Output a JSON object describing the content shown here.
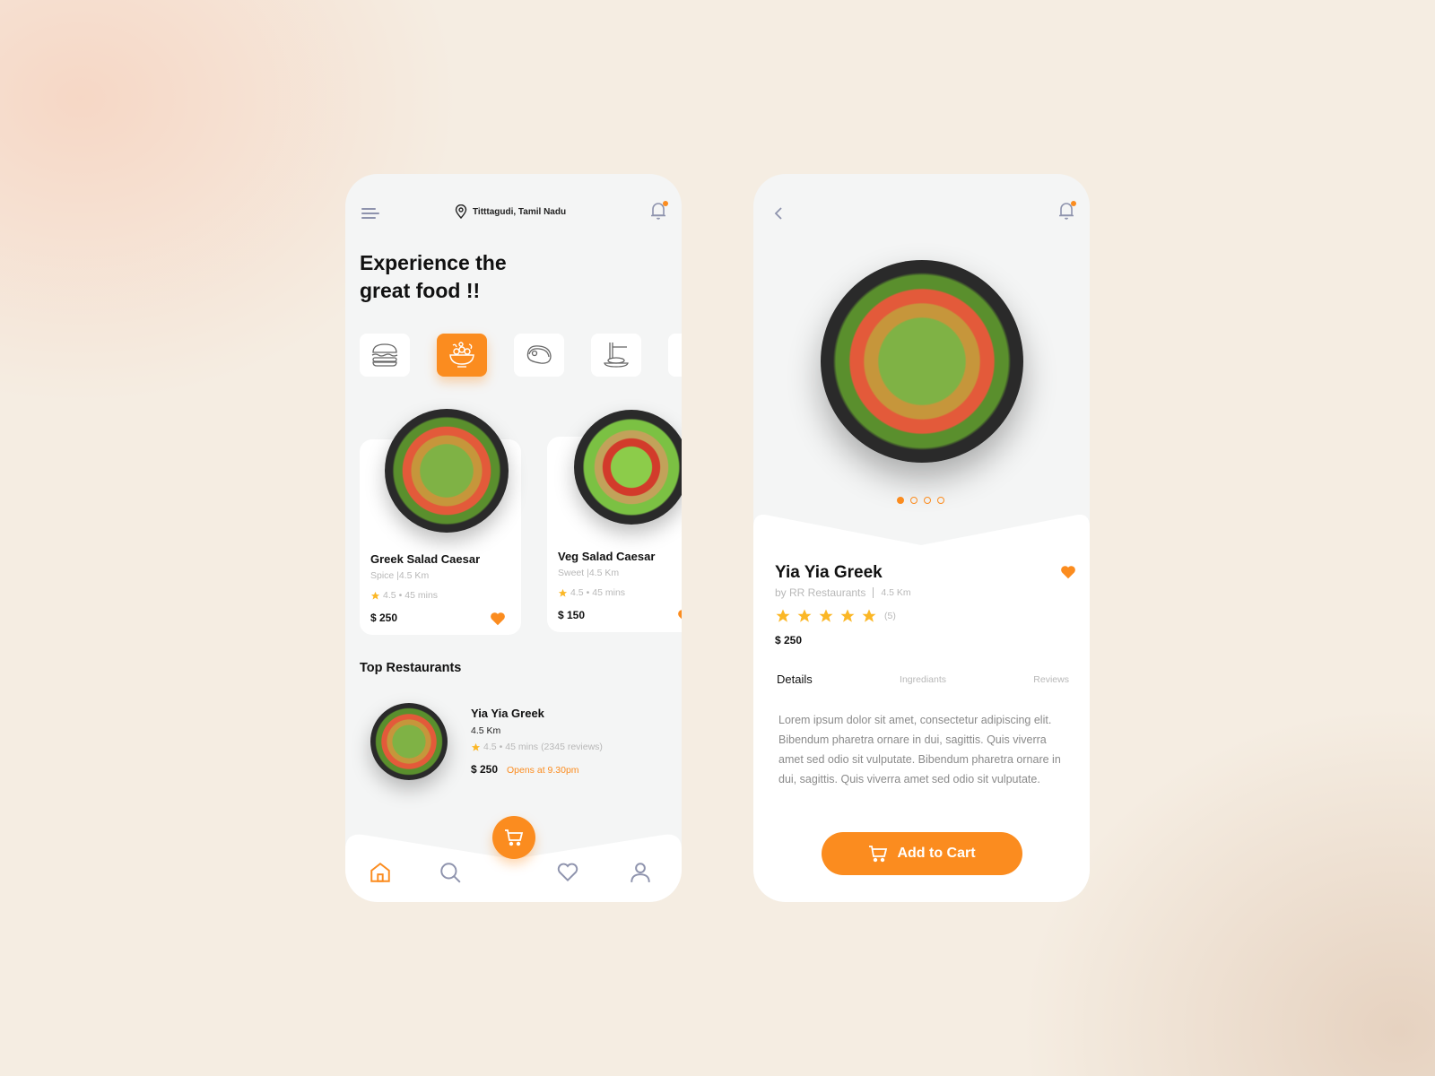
{
  "home": {
    "location": "Titttagudi, Tamil Nadu",
    "headline_line1": "Experience the",
    "headline_line2": "great food !!",
    "categories": [
      {
        "icon": "burger-icon",
        "active": false
      },
      {
        "icon": "salad-bowl-icon",
        "active": true
      },
      {
        "icon": "steak-icon",
        "active": false
      },
      {
        "icon": "noodles-icon",
        "active": false
      },
      {
        "icon": "drink-cup-icon",
        "active": false
      }
    ],
    "food_cards": [
      {
        "title": "Greek Salad Caesar",
        "tag": "Spice",
        "distance": "4.5 Km",
        "rating": "4.5",
        "time": "45 mins",
        "price": "$ 250",
        "favorite": true
      },
      {
        "title": "Veg Salad Caesar",
        "tag": "Sweet",
        "distance": "4.5 Km",
        "rating": "4.5",
        "time": "45 mins",
        "price": "$ 150",
        "favorite": true
      }
    ],
    "section_title": "Top Restaurants",
    "restaurant": {
      "name": "Yia Yia Greek",
      "distance": "4.5 Km",
      "rating": "4.5",
      "time": "45 mins",
      "reviews": "(2345 reviews)",
      "price": "$ 250",
      "opens": "Opens at 9.30pm"
    },
    "nav": [
      "home-icon",
      "search-icon",
      "cart-icon",
      "heart-icon",
      "user-icon"
    ],
    "active_nav": "home"
  },
  "detail": {
    "title": "Yia Yia Greek",
    "by": "by RR Restaurants",
    "distance": "4.5 Km",
    "stars": 5,
    "review_count": "(5)",
    "price": "$ 250",
    "carousel_total": 4,
    "carousel_index": 1,
    "tabs": [
      {
        "label": "Details",
        "active": true
      },
      {
        "label": "Ingrediants",
        "active": false
      },
      {
        "label": "Reviews",
        "active": false
      }
    ],
    "description": "Lorem ipsum dolor sit amet, consectetur adipiscing elit. Bibendum pharetra ornare in dui, sagittis. Quis viverra amet sed odio sit vulputate. Bibendum pharetra ornare in dui, sagittis. Quis viverra amet sed odio sit vulputate.",
    "add_to_cart": "Add to Cart"
  },
  "colors": {
    "accent": "#fb8c1f",
    "star": "#fbb726",
    "icon_gray": "#8e93ad",
    "card_bg": "#f4f5f5"
  }
}
